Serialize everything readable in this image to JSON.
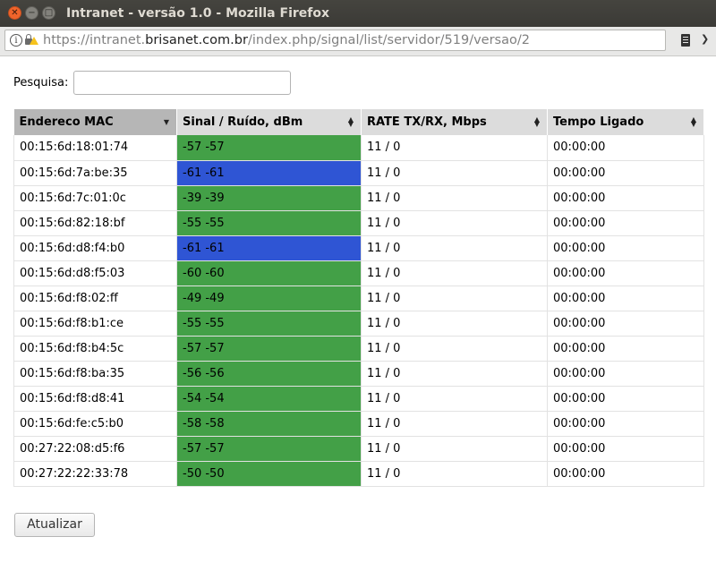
{
  "window": {
    "title": "Intranet - versão 1.0 - Mozilla Firefox"
  },
  "browser": {
    "url_prefix": "https://intranet.",
    "url_domain": "brisanet.com.br",
    "url_path": "/index.php/signal/list/servidor/519/versao/2"
  },
  "search": {
    "label": "Pesquisa:",
    "value": "",
    "placeholder": ""
  },
  "table": {
    "columns": [
      {
        "label": "Endereco MAC",
        "sort": "descending"
      },
      {
        "label": "Sinal / Ruído, dBm",
        "sort": "none"
      },
      {
        "label": "RATE TX/RX, Mbps",
        "sort": "none"
      },
      {
        "label": "Tempo Ligado",
        "sort": "none"
      }
    ],
    "rows": [
      {
        "mac": "00:15:6d:18:01:74",
        "signal": "-57 -57",
        "rate": "11 / 0",
        "uptime": "00:00:00",
        "signal_color": "#43a047"
      },
      {
        "mac": "00:15:6d:7a:be:35",
        "signal": "-61 -61",
        "rate": "11 / 0",
        "uptime": "00:00:00",
        "signal_color": "#2f55d4"
      },
      {
        "mac": "00:15:6d:7c:01:0c",
        "signal": "-39 -39",
        "rate": "11 / 0",
        "uptime": "00:00:00",
        "signal_color": "#43a047"
      },
      {
        "mac": "00:15:6d:82:18:bf",
        "signal": "-55 -55",
        "rate": "11 / 0",
        "uptime": "00:00:00",
        "signal_color": "#43a047"
      },
      {
        "mac": "00:15:6d:d8:f4:b0",
        "signal": "-61 -61",
        "rate": "11 / 0",
        "uptime": "00:00:00",
        "signal_color": "#2f55d4"
      },
      {
        "mac": "00:15:6d:d8:f5:03",
        "signal": "-60 -60",
        "rate": "11 / 0",
        "uptime": "00:00:00",
        "signal_color": "#43a047"
      },
      {
        "mac": "00:15:6d:f8:02:ff",
        "signal": "-49 -49",
        "rate": "11 / 0",
        "uptime": "00:00:00",
        "signal_color": "#43a047"
      },
      {
        "mac": "00:15:6d:f8:b1:ce",
        "signal": "-55 -55",
        "rate": "11 / 0",
        "uptime": "00:00:00",
        "signal_color": "#43a047"
      },
      {
        "mac": "00:15:6d:f8:b4:5c",
        "signal": "-57 -57",
        "rate": "11 / 0",
        "uptime": "00:00:00",
        "signal_color": "#43a047"
      },
      {
        "mac": "00:15:6d:f8:ba:35",
        "signal": "-56 -56",
        "rate": "11 / 0",
        "uptime": "00:00:00",
        "signal_color": "#43a047"
      },
      {
        "mac": "00:15:6d:f8:d8:41",
        "signal": "-54 -54",
        "rate": "11 / 0",
        "uptime": "00:00:00",
        "signal_color": "#43a047"
      },
      {
        "mac": "00:15:6d:fe:c5:b0",
        "signal": "-58 -58",
        "rate": "11 / 0",
        "uptime": "00:00:00",
        "signal_color": "#43a047"
      },
      {
        "mac": "00:27:22:08:d5:f6",
        "signal": "-57 -57",
        "rate": "11 / 0",
        "uptime": "00:00:00",
        "signal_color": "#43a047"
      },
      {
        "mac": "00:27:22:22:33:78",
        "signal": "-50 -50",
        "rate": "11 / 0",
        "uptime": "00:00:00",
        "signal_color": "#43a047"
      }
    ]
  },
  "actions": {
    "refresh_label": "Atualizar"
  }
}
